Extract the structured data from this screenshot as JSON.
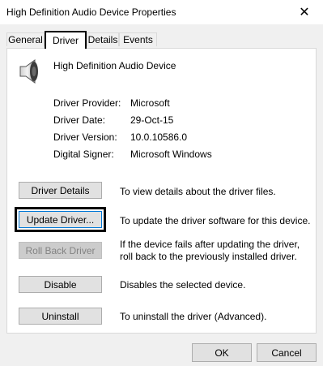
{
  "window": {
    "title": "High Definition Audio Device Properties",
    "close_glyph": "✕"
  },
  "tabs": [
    {
      "label": "General"
    },
    {
      "label": "Driver"
    },
    {
      "label": "Details"
    },
    {
      "label": "Events"
    }
  ],
  "selected_tab": "Driver",
  "device": {
    "name": "High Definition Audio Device",
    "icon": "speaker-icon"
  },
  "driver_info": [
    {
      "label": "Driver Provider:",
      "value": "Microsoft"
    },
    {
      "label": "Driver Date:",
      "value": "29-Oct-15"
    },
    {
      "label": "Driver Version:",
      "value": "10.0.10586.0"
    },
    {
      "label": "Digital Signer:",
      "value": "Microsoft Windows"
    }
  ],
  "actions": [
    {
      "label": "Driver Details",
      "description": "To view details about the driver files.",
      "enabled": true
    },
    {
      "label": "Update Driver...",
      "description": "To update the driver software for this device.",
      "enabled": true
    },
    {
      "label": "Roll Back Driver",
      "description": "If the device fails after updating the driver, roll back to the previously installed driver.",
      "enabled": false
    },
    {
      "label": "Disable",
      "description": "Disables the selected device.",
      "enabled": true
    },
    {
      "label": "Uninstall",
      "description": "To uninstall the driver (Advanced).",
      "enabled": true
    }
  ],
  "footer": {
    "ok_label": "OK",
    "cancel_label": "Cancel"
  },
  "colors": {
    "accent": "#0078d7",
    "panel_bg": "#ffffff",
    "window_bg": "#f0f0f0"
  }
}
